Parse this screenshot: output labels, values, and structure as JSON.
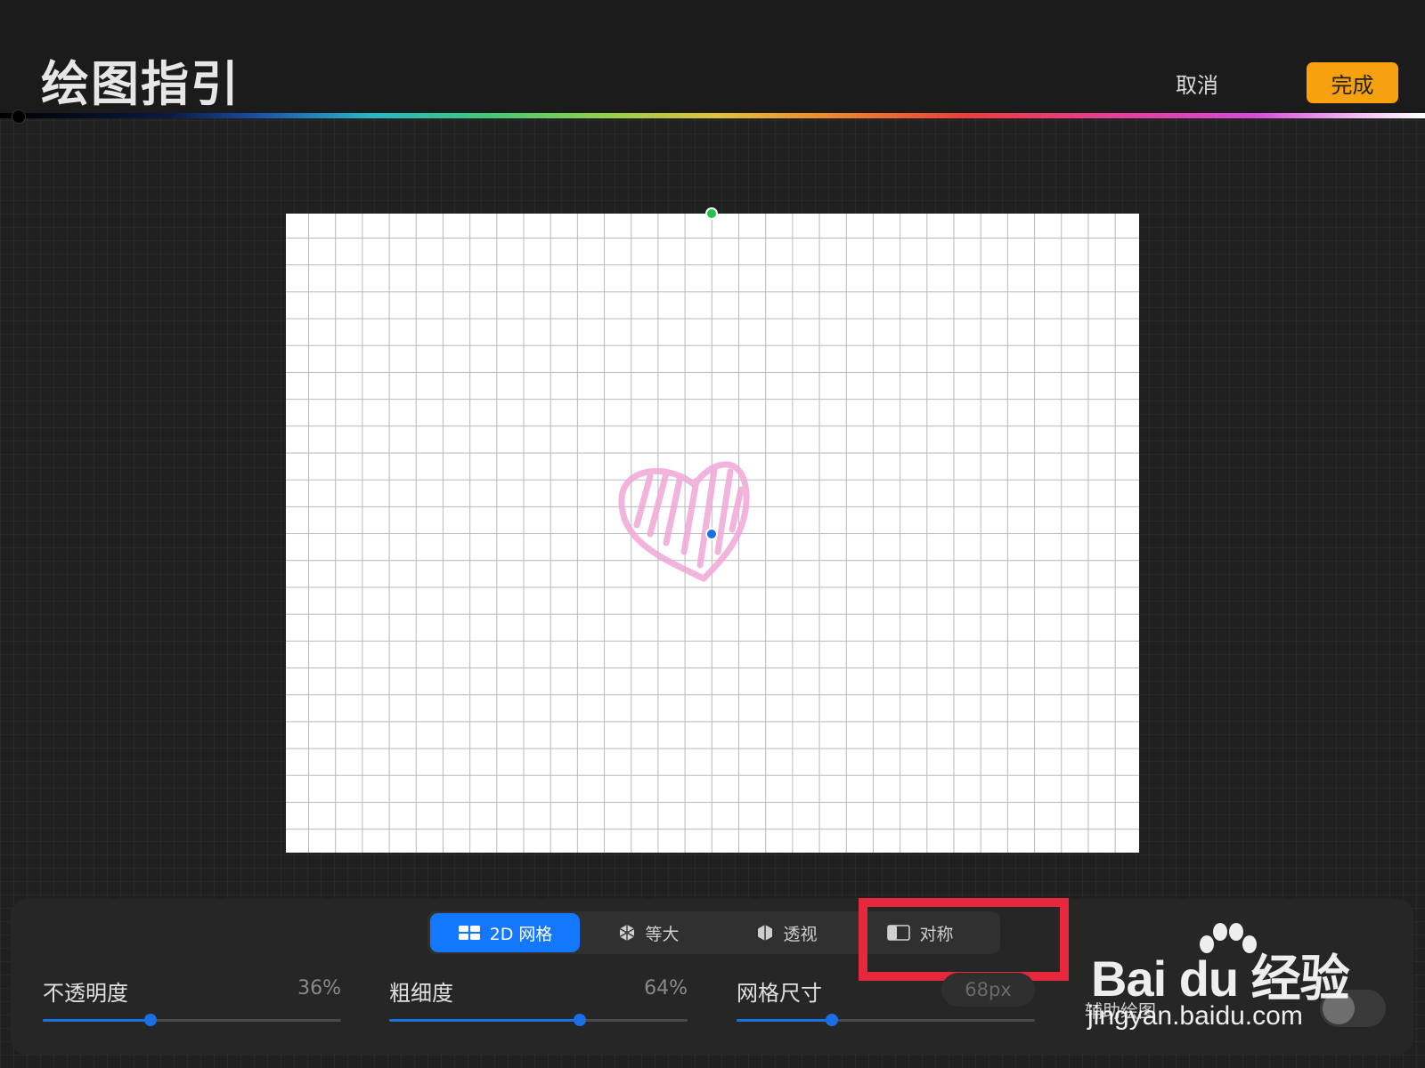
{
  "header": {
    "title": "绘图指引",
    "cancel_label": "取消",
    "done_label": "完成"
  },
  "tabs": [
    {
      "label": "2D 网格",
      "icon": "grid-2d-icon",
      "active": true
    },
    {
      "label": "等大",
      "icon": "isometric-cube-icon",
      "active": false
    },
    {
      "label": "透视",
      "icon": "perspective-icon",
      "active": false
    },
    {
      "label": "对称",
      "icon": "symmetry-icon",
      "active": false
    }
  ],
  "sliders": {
    "opacity": {
      "label": "不透明度",
      "value": "36%",
      "fraction": 0.36
    },
    "thickness": {
      "label": "粗细度",
      "value": "64%",
      "fraction": 0.64
    },
    "grid_size": {
      "label": "网格尺寸",
      "value": "68px",
      "fraction": 0.32
    }
  },
  "assist": {
    "label": "辅助绘图",
    "enabled": false
  },
  "watermark": {
    "brand": "Bai du 经验",
    "url": "jingyan.baidu.com"
  },
  "colors": {
    "accent": "#1478ff",
    "done": "#f7a10f",
    "highlight": "#e6283c",
    "heart": "#f0a8d8"
  }
}
